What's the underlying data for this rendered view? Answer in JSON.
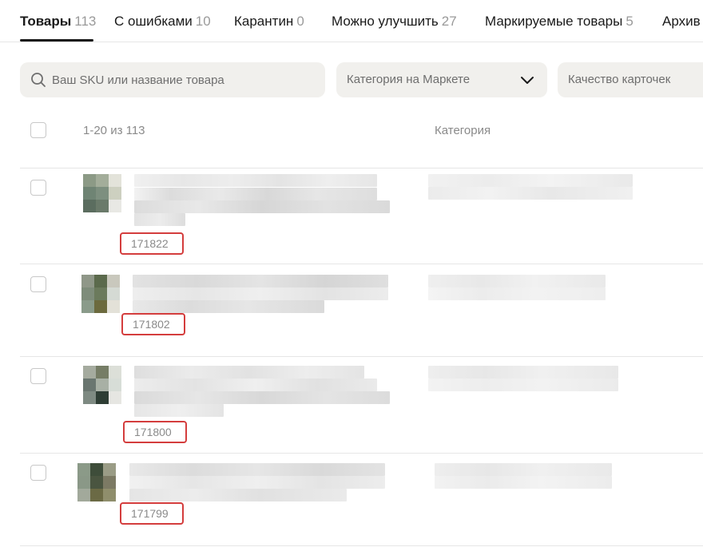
{
  "tabs": [
    {
      "label": "Товары",
      "count": "113"
    },
    {
      "label": "С ошибками",
      "count": "10"
    },
    {
      "label": "Карантин",
      "count": "0"
    },
    {
      "label": "Можно улучшить",
      "count": "27"
    },
    {
      "label": "Маркируемые товары",
      "count": "5"
    },
    {
      "label": "Архив",
      "count": ""
    }
  ],
  "filters": {
    "search_placeholder": "Ваш SKU или название товара",
    "category_label": "Категория на Маркете",
    "quality_label": "Качество карточек"
  },
  "table": {
    "range_label": "1-20 из 113",
    "category_header": "Категория"
  },
  "products": [
    {
      "sku": "171822"
    },
    {
      "sku": "171802"
    },
    {
      "sku": "171800"
    },
    {
      "sku": "171799"
    }
  ],
  "colors": {
    "accent_outline": "#d43d3d",
    "tab_count": "#9a9a9a",
    "filter_bg": "#f1f0ed"
  },
  "icons": {
    "search": "search-icon",
    "dropdown": "chevron-down-icon"
  }
}
